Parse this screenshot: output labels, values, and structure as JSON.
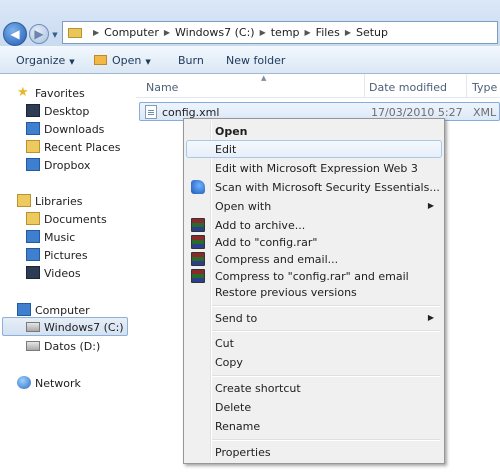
{
  "address_bar": {
    "crumbs": [
      "Computer",
      "Windows7 (C:)",
      "temp",
      "Files",
      "Setup"
    ],
    "separator": "▶",
    "back_icon": "back-arrow-icon",
    "forward_icon": "forward-arrow-icon"
  },
  "toolbar": {
    "organize": "Organize",
    "open": "Open",
    "burn": "Burn",
    "new_folder": "New folder",
    "dropdown_glyph": "▼"
  },
  "nav": {
    "favorites": {
      "label": "Favorites",
      "items": [
        "Desktop",
        "Downloads",
        "Recent Places",
        "Dropbox"
      ]
    },
    "libraries": {
      "label": "Libraries",
      "items": [
        "Documents",
        "Music",
        "Pictures",
        "Videos"
      ]
    },
    "computer": {
      "label": "Computer",
      "items": [
        "Windows7 (C:)",
        "Datos (D:)"
      ],
      "selected": "Windows7 (C:)"
    },
    "network": {
      "label": "Network"
    }
  },
  "filelist": {
    "columns": {
      "name": "Name",
      "date": "Date modified",
      "type": "Type"
    },
    "sort_glyph": "▲",
    "files": [
      {
        "name": "config.xml",
        "date": "17/03/2010 5:27",
        "type": "XML I"
      }
    ]
  },
  "context_menu": {
    "items": [
      {
        "label": "Open",
        "bold": true
      },
      {
        "label": "Edit",
        "highlighted": true
      },
      {
        "label": "Edit with Microsoft Expression Web 3"
      },
      {
        "label": "Scan with Microsoft Security Essentials...",
        "icon": "security-essentials-icon"
      },
      {
        "label": "Open with",
        "submenu": true
      },
      {
        "label": "Add to archive...",
        "icon": "winrar-icon"
      },
      {
        "label": "Add to \"config.rar\"",
        "icon": "winrar-icon"
      },
      {
        "label": "Compress and email...",
        "icon": "winrar-icon"
      },
      {
        "label": "Compress to \"config.rar\" and email",
        "icon": "winrar-icon"
      },
      {
        "label": "Restore previous versions"
      },
      {
        "label": "Send to",
        "submenu": true
      },
      {
        "label": "Cut"
      },
      {
        "label": "Copy"
      },
      {
        "label": "Create shortcut"
      },
      {
        "label": "Delete"
      },
      {
        "label": "Rename"
      },
      {
        "label": "Properties"
      }
    ],
    "submenu_glyph": "▶"
  }
}
